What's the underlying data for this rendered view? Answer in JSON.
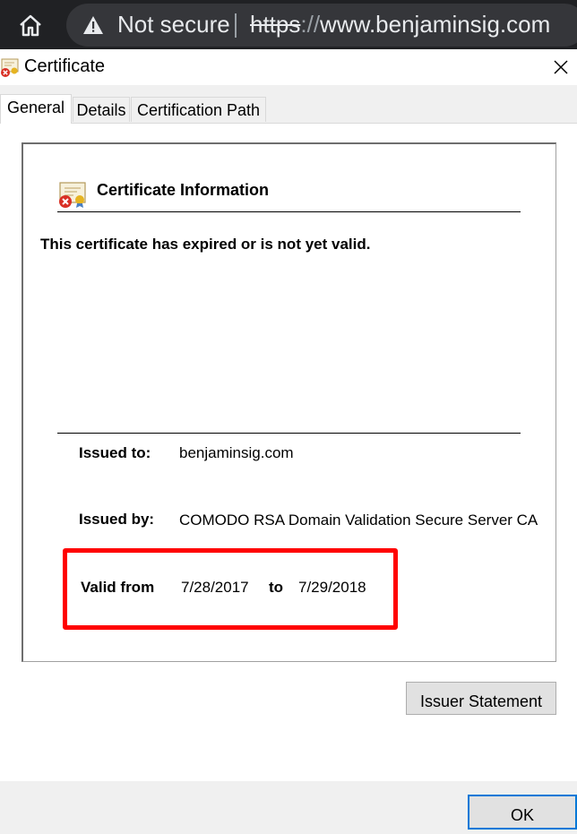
{
  "browser": {
    "security_label": "Not secure",
    "url_scheme": "https",
    "url_slashes": "://",
    "url_host": "www.benjaminsig.com"
  },
  "dialog": {
    "title": "Certificate",
    "tabs": [
      {
        "label": "General",
        "active": true
      },
      {
        "label": "Details",
        "active": false
      },
      {
        "label": "Certification Path",
        "active": false
      }
    ],
    "info": {
      "heading": "Certificate Information",
      "status_message": "This certificate has expired or is not yet valid.",
      "issued_to_label": "Issued to:",
      "issued_to_value": "benjaminsig.com",
      "issued_by_label": "Issued by:",
      "issued_by_value": "COMODO RSA Domain Validation Secure Server CA",
      "valid_from_label": "Valid from",
      "valid_from_value": "7/28/2017",
      "valid_to_label": "to",
      "valid_to_value": "7/29/2018"
    },
    "issuer_statement_label": "Issuer Statement",
    "ok_label": "OK"
  },
  "colors": {
    "highlight": "#ff0000",
    "default_button_border": "#0078d7",
    "browser_bar": "#202124"
  },
  "icons": [
    "home-icon",
    "warning-icon",
    "certificate-error-icon",
    "close-icon"
  ]
}
